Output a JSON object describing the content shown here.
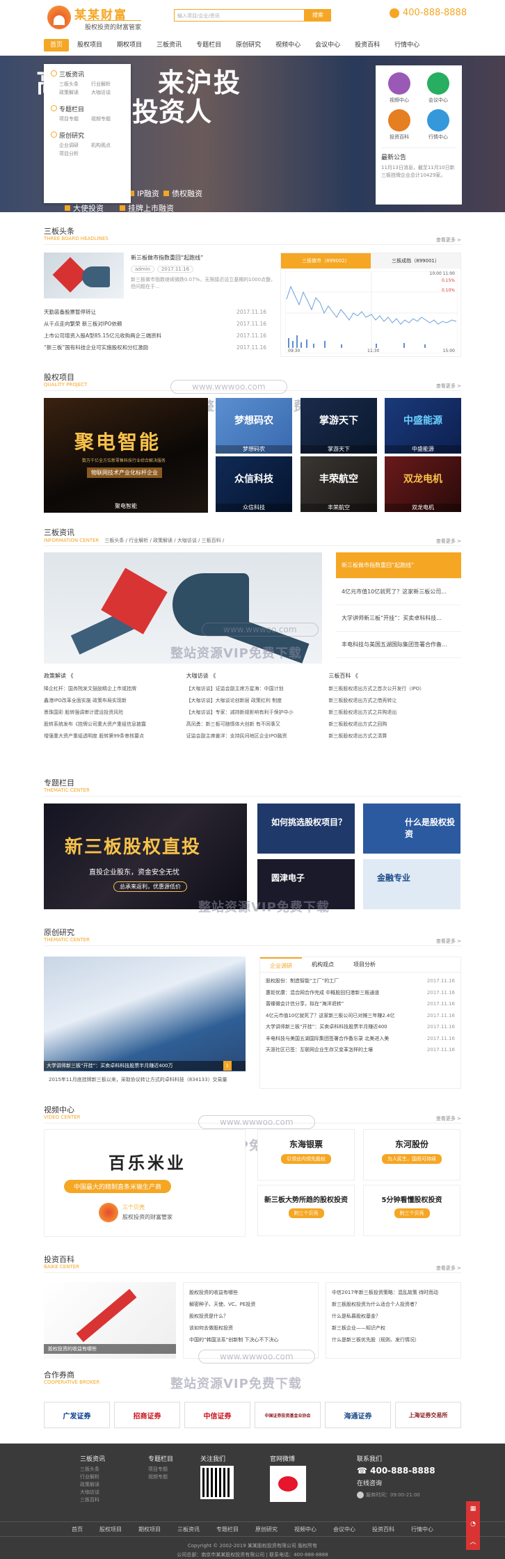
{
  "header": {
    "brand": "某某财富",
    "slogan": "股权投资的财富管家",
    "search_placeholder": "输入项目/企业/资讯",
    "search_button": "搜索",
    "phone": "400-888-8888"
  },
  "nav": [
    "首页",
    "股权项目",
    "期权项目",
    "三板资讯",
    "专题栏目",
    "原创研究",
    "视频中心",
    "会议中心",
    "投资百科",
    "行情中心"
  ],
  "banner": {
    "title1": "高端",
    "title1b": "来沪投",
    "title2": "投资人",
    "items": [
      "IP融资",
      "债权融资",
      "大使投资",
      "挂牌上市融资"
    ]
  },
  "dropdown": [
    {
      "title": "三板资讯",
      "subs": [
        "三板头条",
        "行业解析",
        "政策解读",
        "大咖访谈"
      ]
    },
    {
      "title": "专题栏目",
      "subs": [
        "项目专题",
        "视频专题"
      ]
    },
    {
      "title": "原创研究",
      "subs": [
        "企业调研",
        "机构观点",
        "项目分析"
      ]
    }
  ],
  "quick": {
    "items": [
      {
        "label": "视频中心",
        "color": "#9b59b6"
      },
      {
        "label": "会议中心",
        "color": "#27ae60"
      },
      {
        "label": "投资百科",
        "color": "#e67e22"
      },
      {
        "label": "行情中心",
        "color": "#3498db"
      }
    ],
    "notice_title": "最新公告",
    "notice_text": "11月13日消息，截至11月10日新三板挂牌企业总计10429家。"
  },
  "sections": {
    "headlines": {
      "cn": "三板头条",
      "en": "THREE BOARD HEADLINES",
      "more": "查看更多 >"
    },
    "equity": {
      "cn": "股权项目",
      "en": "QUALITY PROJECT",
      "more": "查看更多 >"
    },
    "info": {
      "cn": "三板资讯",
      "en": "INFORMATION CENTER",
      "more": "查看更多 >",
      "cats": "三板头条 / 行业解析 / 政策解读 / 大咖访谈 / 三板百科 /"
    },
    "thematic": {
      "cn": "专题栏目",
      "en": "THEMATIC CENTER",
      "more": "查看更多 >"
    },
    "original": {
      "cn": "原创研究",
      "en": "THEMATIC CENTER",
      "more": "查看更多 >"
    },
    "video": {
      "cn": "视频中心",
      "en": "VIDEO CENTER",
      "more": "查看更多 >"
    },
    "baike": {
      "cn": "投资百科",
      "en": "BAIKE CENTER",
      "more": "查看更多 >"
    },
    "brokers": {
      "cn": "合作券商",
      "en": "COOPERATIVE BROKER"
    }
  },
  "watermark": {
    "url": "www.wwwoo.com",
    "text": "整站资源VIP免费下载"
  },
  "headline": {
    "title": "新三板做市指数重回“起跑线”",
    "tags": [
      "admin",
      "2017.11.16"
    ],
    "desc": "新三板做市指数继续微跌0.07%，无限接近设立基期的1000点整，但问题在于...",
    "news": [
      {
        "t": "天勤装备股票暂停转让",
        "d": "2017.11.16"
      },
      {
        "t": "从千点走向繁荣 新三板对IPO依赖",
        "d": "2017.11.16"
      },
      {
        "t": "上市公司增资入股A型85.15亿元收购两企三端资料",
        "d": "2017.11.16"
      },
      {
        "t": "“新三板”国有科技企业可实施股权和分红激励",
        "d": "2017.11.16"
      }
    ]
  },
  "market": {
    "tabs": [
      "三板做市（899002）",
      "三板成指（899001）"
    ],
    "times": [
      "09:30",
      "11:30",
      "15:00"
    ],
    "top_right": [
      "10:00 11:00",
      "0.15%",
      "0.10%"
    ]
  },
  "equity_items": [
    {
      "title": "聚电智能",
      "sub": "数万千亿全方位新零售科技行业综合解决服务",
      "badge": "物联网技术产业化标杆企业",
      "caption": "聚电智能"
    },
    {
      "title": "梦想码农",
      "caption": "梦想码农",
      "bg": "#4a78b8"
    },
    {
      "title": "掌游天下",
      "caption": "掌游天下",
      "bg": "#1a2a4a"
    },
    {
      "title": "中盛能源",
      "caption": "中盛能源",
      "bg": "#15356a"
    },
    {
      "title": "众信科技",
      "caption": "众信科技",
      "bg": "#102a55"
    },
    {
      "title": "丰荣航空",
      "caption": "丰荣航空",
      "bg": "#33302e"
    },
    {
      "title": "双龙电机",
      "caption": "双龙电机",
      "bg": "#5a1a1a"
    }
  ],
  "info": {
    "list": [
      "新三板做市指数重回“起跑线”",
      "4亿元市值10亿就死了？这家新三板公司...",
      "大学讲师新三板“开挂”：买卖卓科科技...",
      "丰电科技与美国五湖国际集团签署合作备..."
    ],
    "cols": [
      {
        "h": "政策解读 《",
        "items": [
          "降企杠杆：国务院发文鼓励精企上市或挂牌",
          "鑫港IPO改革全面实施 政策布局实现新",
          "景珠国彩 股转强调审计建设投资风险",
          "股转系统发布《挂牌公司重大资产重组信息披露",
          "增强重大资产重组透明度 股转第99条审核要点"
        ]
      },
      {
        "h": "大咖访谈 《",
        "items": [
          "【大咖访谈】证监会副主席方星海：中国计划",
          "【大咖访谈】大咖谈论创新层 政策红利 制度",
          "【大咖访谈】专家：减持新规影响有利于保护中小",
          "高凤勇：新三板可随情体大创新 有不同事又",
          "证监会副主席姜洋：支持民间地区企业IPO融资"
        ]
      },
      {
        "h": "三板百科 《",
        "items": [
          "新三板股权退出方式之首次公开发行（IPO）",
          "新三板股权退出方式之借壳转让",
          "新三板股权退出方式之并购退出",
          "新三板股权退出方式之回购",
          "新三板股权退出方式之清算"
        ]
      }
    ]
  },
  "thematic": {
    "big_title": "新三板股权直投",
    "big_sub": "直投企业股东，资金安全无忧",
    "big_btn": "总承来返利，优惠源低价",
    "items": [
      {
        "title": "如何挑选股权项目？",
        "bg": "#1f3a6a",
        "color": "#ffffff"
      },
      {
        "title": "什么是股权投资",
        "bg": "#2c5aa0",
        "color": "#ffffff"
      },
      {
        "title": "圆津电子",
        "bg": "#1a1a2a",
        "color": "#ffffff"
      },
      {
        "title": "金融专业",
        "bg": "#dfeaf5",
        "color": "#1c4b8a"
      }
    ]
  },
  "original": {
    "caption": "大学讲师新三板“开挂”：买卖卓科科技股票半月赚近400万",
    "pager": "1",
    "desc": "2015年11月底挂牌新三板以来，采取协议转让方式的卓科科技（834133）交易量",
    "tabs": [
      "企业调研",
      "机构观点",
      "项目分析"
    ],
    "items": [
      {
        "t": "股权股份：制造智能“工厂”的工厂",
        "d": "2017.11.16"
      },
      {
        "t": "惠钜优康：混合网合作完成 中概股回归港新三板通道",
        "d": "2017.11.16"
      },
      {
        "t": "蔷蝶微会计信分享，拟在“海洋退转”",
        "d": "2017.11.16"
      },
      {
        "t": "4亿元市值10亿就死了？这家新三板公司已对摊三年赚2.4亿",
        "d": "2017.11.16"
      },
      {
        "t": "大学讲师新三板“开挂”：买卖卓科科技股票半月赚近400",
        "d": "2017.11.16"
      },
      {
        "t": "丰电科技与美国五湖国际集团签署合作备忘录 北美进入美",
        "d": "2017.11.16"
      },
      {
        "t": "天涯社区已签：互联网企业生存又变革怎样的土壤",
        "d": "2017.11.16"
      }
    ]
  },
  "video": {
    "big_title": "百乐米业",
    "big_sub": "中国最大的精制直条米输生产商",
    "logo_name": "三个贝壳",
    "logo_sub": "股权投资的财富管家",
    "items": [
      {
        "title": "东海银票",
        "btn": "引领业内领先股权"
      },
      {
        "title": "东河股份",
        "btn": "为人民生，国而可持续"
      },
      {
        "title": "新三板大势所趋的股权投资",
        "btn": "附三个贝壳"
      },
      {
        "title": "5分钟看懂股权投资",
        "btn": "附三个贝壳"
      }
    ]
  },
  "baike": {
    "caption": "股权投资的收益有哪些",
    "list1": [
      "股权投资的收益有哪些",
      "解密种子、天使、VC、PE投资",
      "股权投资是什么？",
      "该如何去做股权投资",
      "中国的“韩国法系”创新制 下决心不下决心"
    ],
    "list2": [
      "中信2017年新三板投资策略：混乱故策 待时而动",
      "新三板股权投资为什么适合个人投资者？",
      "什么是私募股权基金？",
      "新三板企业——知识产权",
      "什么是新三板优先股（规则、发行情况）"
    ]
  },
  "brokers": [
    {
      "name": "广发证券",
      "color": "#003a8c"
    },
    {
      "name": "招商证券",
      "color": "#c8161d"
    },
    {
      "name": "中信证券",
      "color": "#c8161d"
    },
    {
      "name": "中国证券投资基金业协会",
      "color": "#8b1a1a"
    },
    {
      "name": "海通证券",
      "color": "#1c4b8a"
    },
    {
      "name": "上海证券交易所",
      "color": "#8b1a1a"
    }
  ],
  "footer": {
    "col1_h": "三板资讯",
    "col1": [
      "三板头条",
      "行业解析",
      "政策解读",
      "大咖访谈",
      "三板百科"
    ],
    "col2_h": "专题栏目",
    "col2": [
      "项目专题",
      "视频专题"
    ],
    "col3_h": "关注我们",
    "col4_h": "官网微博",
    "col5_h": "联系我们",
    "phone": "400-888-8888",
    "online": "在线咨询",
    "hours": "服务时间：09:00-21:00",
    "nav": [
      "首页",
      "股权项目",
      "期权项目",
      "三板资讯",
      "专题栏目",
      "原创研究",
      "视频中心",
      "会议中心",
      "投资百科",
      "行情中心"
    ],
    "copyright": "Copyright © 2002-2019 某某股权投资有限公司 版权所有",
    "address": "公司总部：南京市某某股权投资有限公司 | 联系电话：400-888-8888"
  }
}
